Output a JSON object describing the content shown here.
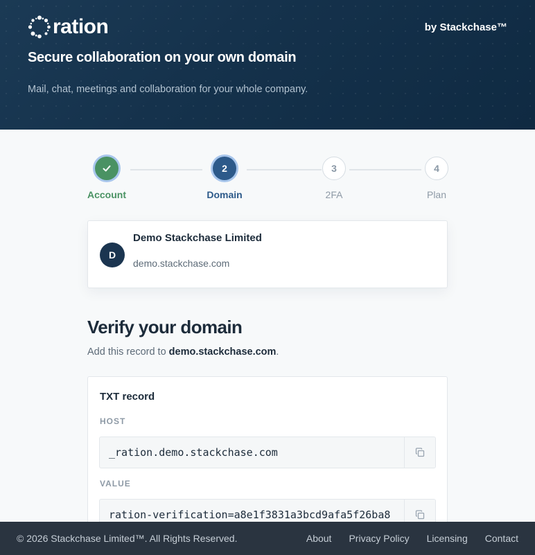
{
  "header": {
    "logo_text": "ration",
    "byline": "by Stackchase™",
    "tagline": "Secure collaboration on your own domain",
    "subtagline": "Mail, chat, meetings and collaboration for your whole company."
  },
  "stepper": {
    "current_step": 2,
    "steps": [
      {
        "number": "1",
        "label": "Account",
        "state": "done"
      },
      {
        "number": "2",
        "label": "Domain",
        "state": "active"
      },
      {
        "number": "3",
        "label": "2FA",
        "state": "todo"
      },
      {
        "number": "4",
        "label": "Plan",
        "state": "todo"
      }
    ]
  },
  "organization": {
    "avatar_initial": "D",
    "name": "Demo Stackchase Limited",
    "domain": "demo.stackchase.com"
  },
  "verify": {
    "title": "Verify your domain",
    "instruction_prefix": "Add this record to ",
    "instruction_domain": "demo.stackchase.com",
    "instruction_suffix": "."
  },
  "record": {
    "type_label": "TXT record",
    "host_label": "HOST",
    "host_value": "_ration.demo.stackchase.com",
    "value_label": "VALUE",
    "value_value": "ration-verification=a8e1f3831a3bcd9afa5f26ba8"
  },
  "footer": {
    "copyright": "© 2026 Stackchase Limited™. All Rights Reserved.",
    "links": [
      "About",
      "Privacy Policy",
      "Licensing",
      "Contact"
    ]
  },
  "colors": {
    "header_bg": "#15324c",
    "step_done": "#4a9263",
    "step_active": "#2d5a8a",
    "footer_bg": "#2a3440"
  },
  "icons": {
    "logo": "ration-logo-icon",
    "step_done": "check-icon",
    "copy": "copy-icon"
  }
}
